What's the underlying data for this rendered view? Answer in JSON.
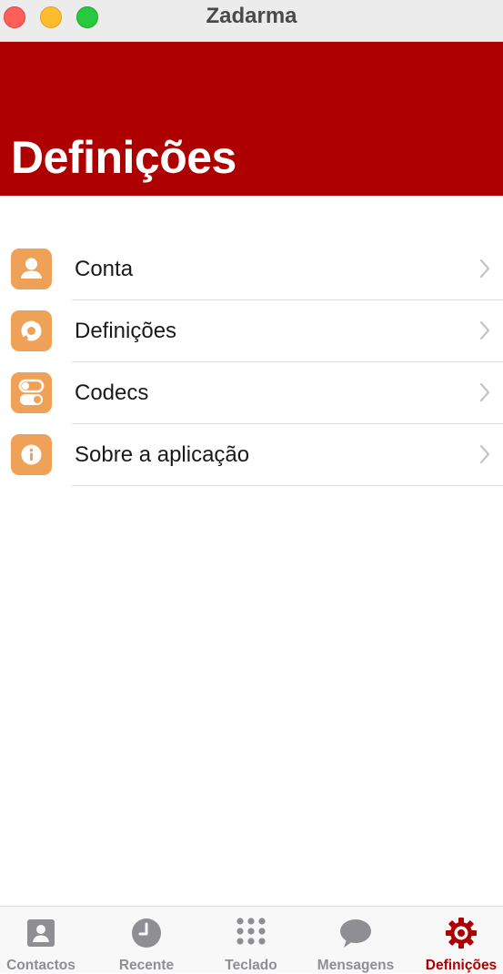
{
  "window": {
    "title": "Zadarma"
  },
  "header": {
    "title": "Definições"
  },
  "settings_items": [
    {
      "label": "Conta",
      "icon": "person-icon"
    },
    {
      "label": "Definições",
      "icon": "phone-settings-icon"
    },
    {
      "label": "Codecs",
      "icon": "toggles-icon"
    },
    {
      "label": "Sobre a aplicação",
      "icon": "info-icon"
    }
  ],
  "tabs": [
    {
      "label": "Contactos",
      "icon": "contacts-icon"
    },
    {
      "label": "Recente",
      "icon": "clock-icon"
    },
    {
      "label": "Teclado",
      "icon": "keypad-icon"
    },
    {
      "label": "Mensagens",
      "icon": "chat-bubble-icon"
    },
    {
      "label": "Definições",
      "icon": "gear-icon",
      "active": true
    }
  ],
  "colors": {
    "brand_red": "#ae0000",
    "icon_orange": "#f0a158",
    "tab_inactive": "#8e8e93"
  }
}
